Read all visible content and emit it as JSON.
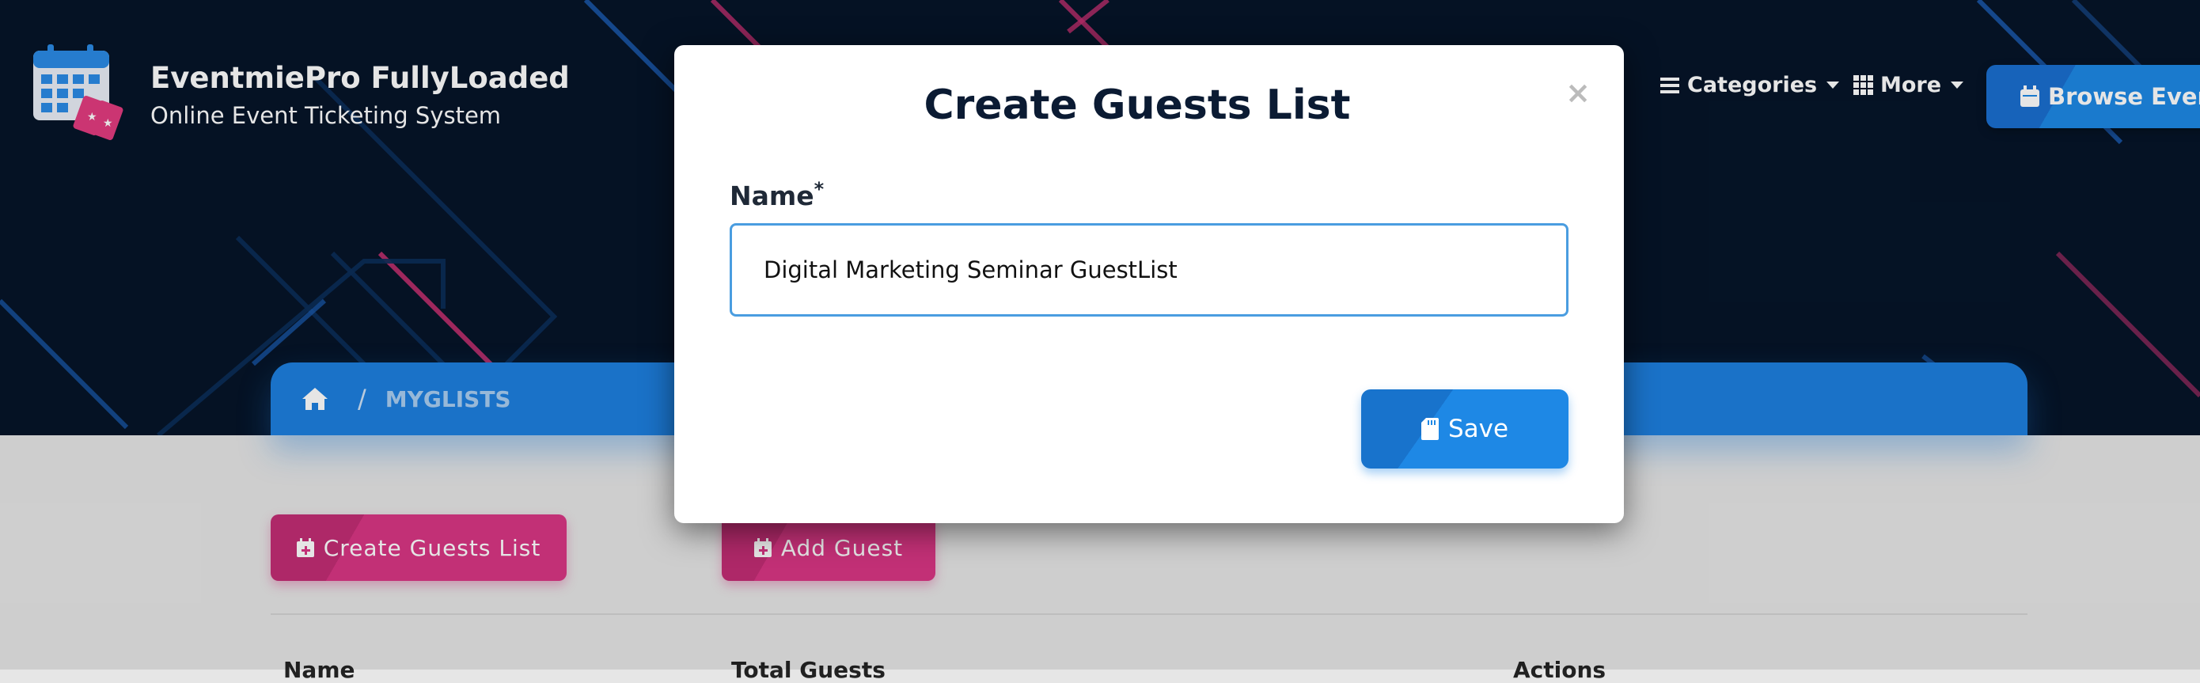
{
  "brand": {
    "title": "EventmiePro FullyLoaded",
    "subtitle": "Online Event Ticketing System",
    "logo_icon": "calendar-ticket-icon"
  },
  "nav": {
    "categories_label": "Categories",
    "more_label": "More",
    "browse_label": "Browse Events"
  },
  "breadcrumb": {
    "home_icon": "home-icon",
    "current": "MYGLISTS"
  },
  "page": {
    "create_list_label": "Create Guests List",
    "add_guest_label": "Add Guest",
    "columns": [
      "Name",
      "Total Guests",
      "Actions"
    ]
  },
  "modal": {
    "title": "Create Guests List",
    "close_symbol": "×",
    "name_label": "Name",
    "required_mark": "*",
    "name_value": "Digital Marketing Seminar GuestList",
    "save_label": "Save"
  },
  "colors": {
    "hero_bg": "#061529",
    "primary_blue": "#1e88e5",
    "pink": "#d93684",
    "page_bg": "#e6e6e6"
  }
}
